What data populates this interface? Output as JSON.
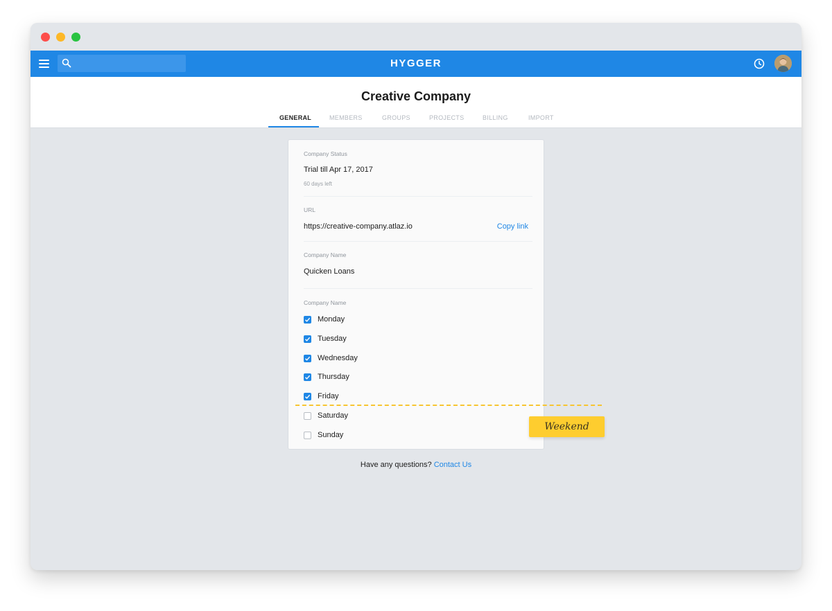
{
  "app": {
    "brand": "HYGGER",
    "colors": {
      "primary": "#1f87e5",
      "sticker": "#fecd2f",
      "dashed_line": "#f7c531"
    },
    "icons": [
      "menu-icon",
      "search-icon",
      "clock-icon",
      "avatar"
    ]
  },
  "header": {
    "title": "Creative Company",
    "tabs": [
      {
        "label": "GENERAL",
        "active": true
      },
      {
        "label": "MEMBERS",
        "active": false
      },
      {
        "label": "GROUPS",
        "active": false
      },
      {
        "label": "PROJECTS",
        "active": false
      },
      {
        "label": "BILLING",
        "active": false
      },
      {
        "label": "IMPORT",
        "active": false
      }
    ]
  },
  "card": {
    "status": {
      "label": "Company Status",
      "value": "Trial till Apr 17, 2017",
      "sub": "60 days left"
    },
    "url": {
      "label": "URL",
      "value": "https://creative-company.atlaz.io",
      "action": "Copy link"
    },
    "name": {
      "label": "Company Name",
      "value": "Quicken Loans"
    },
    "workdays": {
      "label": "Company Name",
      "days": [
        {
          "label": "Monday",
          "checked": true
        },
        {
          "label": "Tuesday",
          "checked": true
        },
        {
          "label": "Wednesday",
          "checked": true
        },
        {
          "label": "Thursday",
          "checked": true
        },
        {
          "label": "Friday",
          "checked": true
        },
        {
          "label": "Saturday",
          "checked": false
        },
        {
          "label": "Sunday",
          "checked": false
        }
      ]
    }
  },
  "annotation": {
    "weekend_label": "Weekend"
  },
  "footer": {
    "question": "Have any questions?",
    "contact": "Contact Us"
  }
}
